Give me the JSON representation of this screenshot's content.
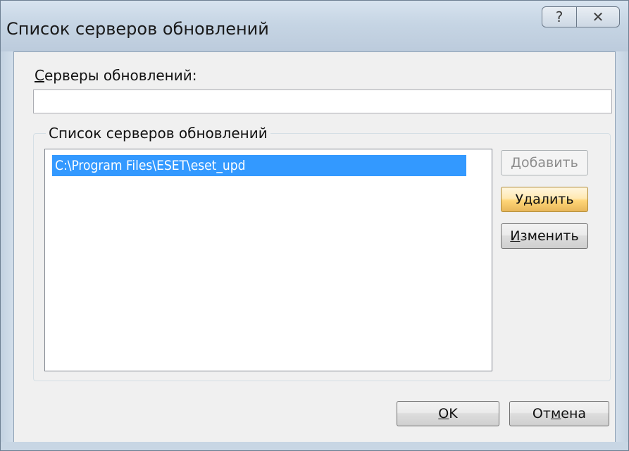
{
  "window": {
    "title": "Список серверов обновлений",
    "help_button": "?",
    "close_button": "✕"
  },
  "servers_label": {
    "first": "С",
    "rest": "ерверы обновлений:"
  },
  "servers_input": {
    "value": ""
  },
  "group": {
    "title": "Список серверов обновлений",
    "items": [
      "C:\\Program Files\\ESET\\eset_upd"
    ],
    "selected_index": 0
  },
  "buttons": {
    "add": {
      "first": "Д",
      "rest": "обавить",
      "enabled": false
    },
    "remove": {
      "label": "Удалить",
      "enabled": true
    },
    "edit": {
      "first": "И",
      "rest": "зменить",
      "enabled": true
    },
    "ok": {
      "first": "O",
      "rest": "K"
    },
    "cancel": {
      "pre": "От",
      "u": "м",
      "post": "ена"
    }
  }
}
